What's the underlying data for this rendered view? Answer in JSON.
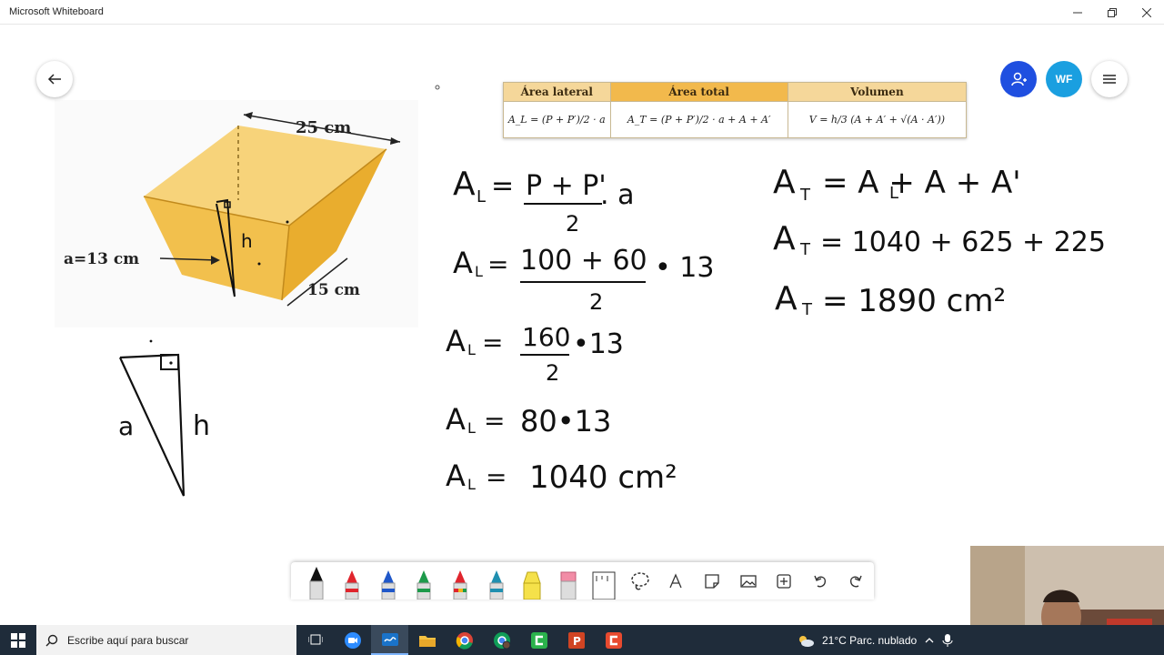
{
  "window": {
    "title": "Microsoft Whiteboard"
  },
  "header": {
    "avatar_initials": "WF"
  },
  "formula_table": {
    "columns": [
      {
        "header": "Área lateral",
        "formula": "A_L = (P + P′)/2 · a"
      },
      {
        "header": "Área total",
        "formula": "A_T = (P + P′)/2 · a + A + A′"
      },
      {
        "header": "Volumen",
        "formula": "V = h/3 (A + A′ + √(A · A′))"
      }
    ]
  },
  "figure": {
    "top_edge": "25 cm",
    "bottom_edge": "15 cm",
    "apothem": "a=13 cm",
    "height_label": "h"
  },
  "sketch": {
    "label_a": "a",
    "label_h": "h"
  },
  "work_lateral": {
    "line1_lhs": "A",
    "line1_sub": "L",
    "line1_num": "P + P'",
    "line1_den": "2",
    "line1_tail": ". a",
    "line2_num": "100 + 60",
    "line2_den": "2",
    "line2_tail": "• 13",
    "line3_num": "160",
    "line3_den": "2",
    "line3_tail": "•13",
    "line4_rhs": "80•13",
    "line5_rhs": "1040 cm²"
  },
  "work_total": {
    "line1": "= A  + A + A'",
    "line1_sub": "L",
    "line2": "= 1040 + 625 + 225",
    "line3": "= 1890  cm²"
  },
  "taskbar": {
    "search_placeholder": "Escribe aquí para buscar",
    "weather": "21°C  Parc. nublado"
  },
  "colors": {
    "taskbar": "#1f2c3a",
    "share": "#1f4fe0",
    "avatar": "#1a9fe0",
    "table_header": "#f5d79a",
    "table_header_active": "#f2b94c",
    "prism": "#f2c04d"
  }
}
